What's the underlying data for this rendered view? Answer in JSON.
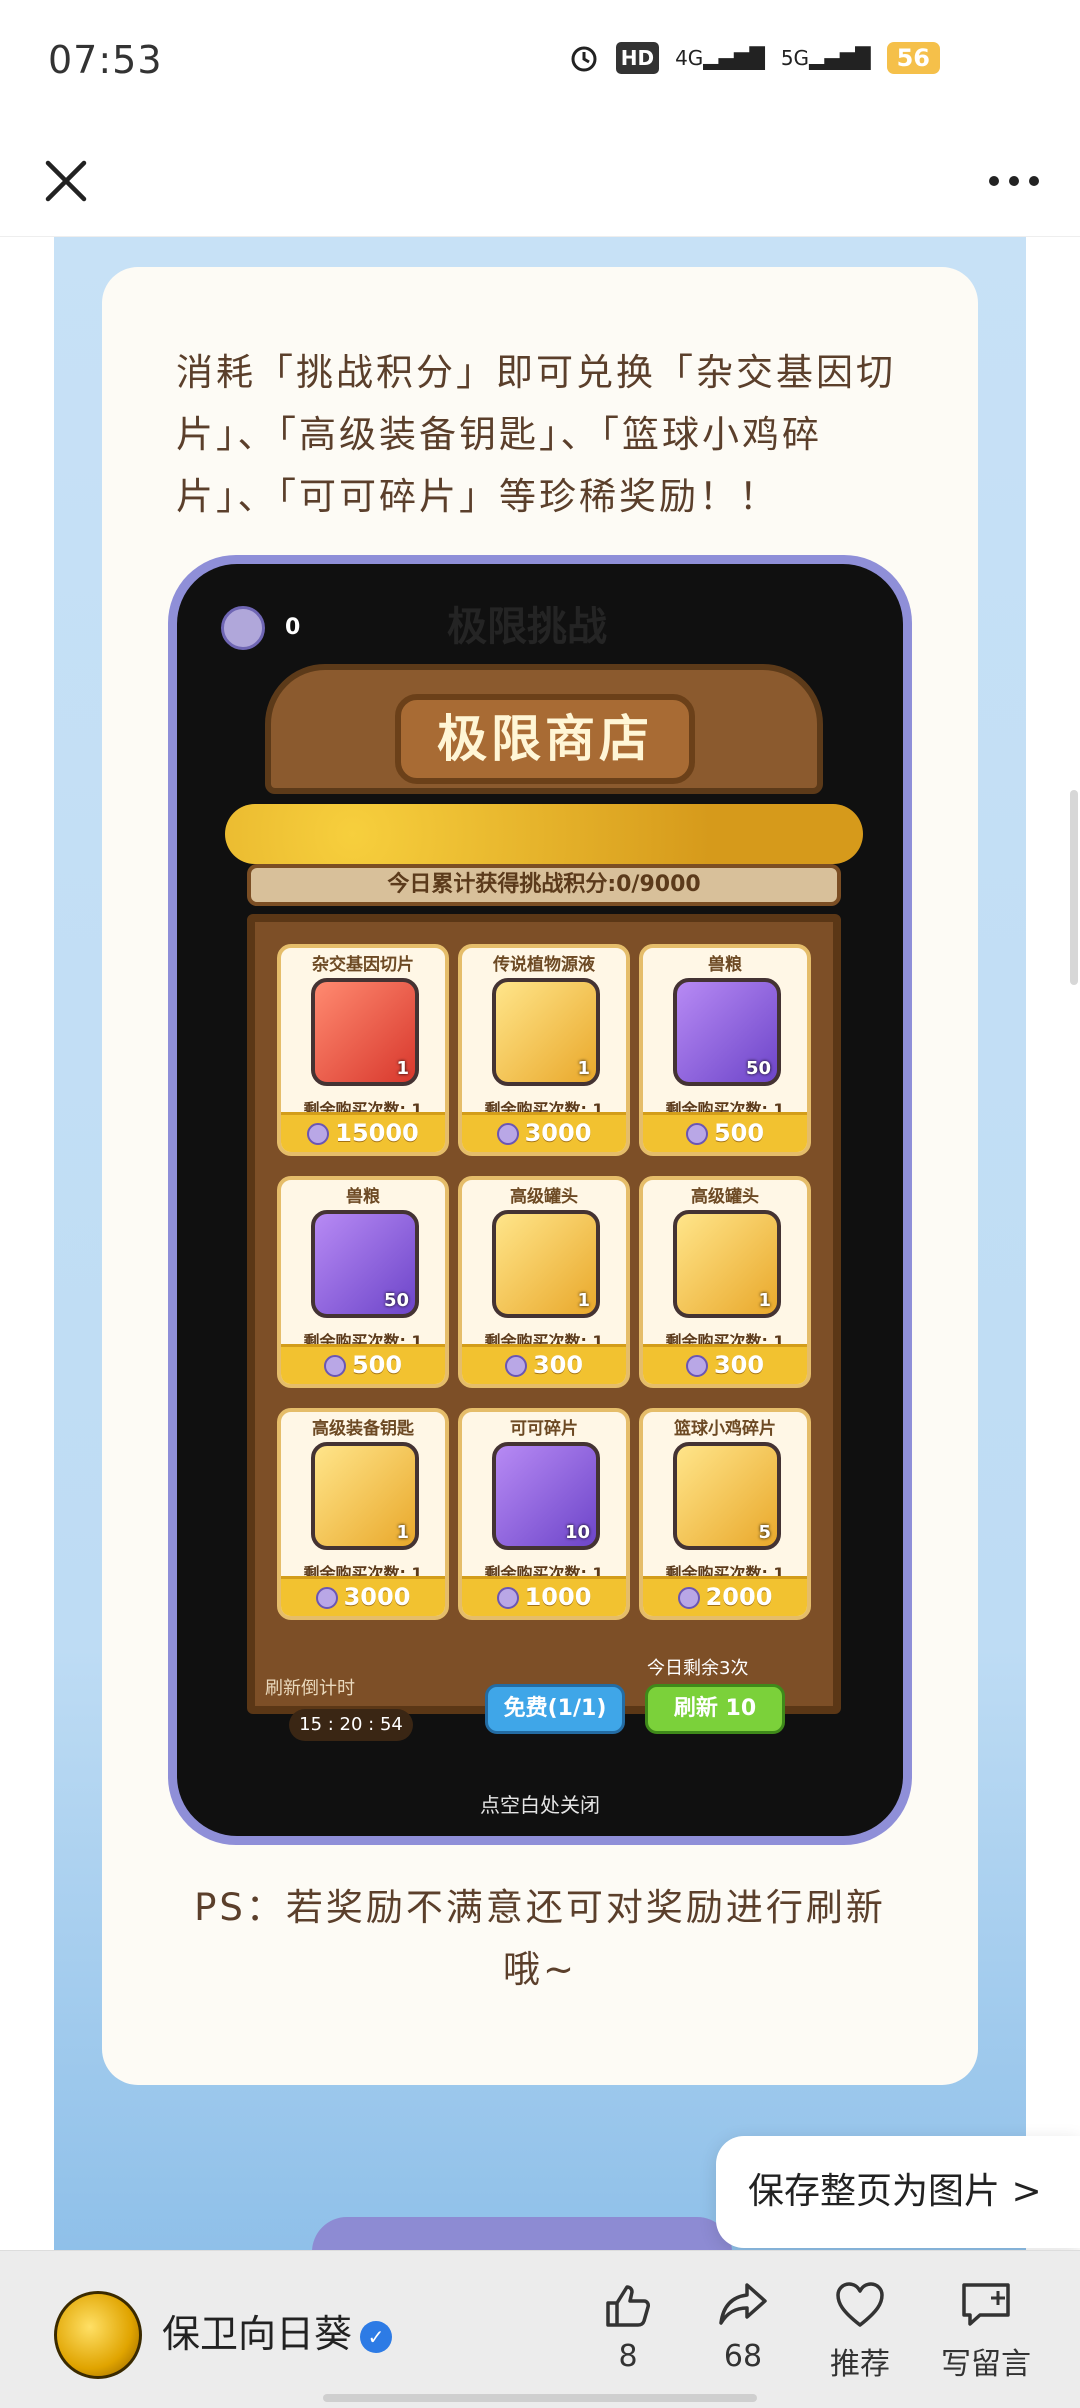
{
  "status_bar": {
    "time": "07:53",
    "hd": "HD",
    "net1": "4G",
    "net2": "5G",
    "battery": "56"
  },
  "article": {
    "intro": "消耗「挑战积分」即可兑换「杂交基因切片」、「高级装备钥匙」、「篮球小鸡碎片」、「可可碎片」等珍稀奖励！！",
    "ps": "PS：若奖励不满意还可对奖励进行刷新哦~"
  },
  "game": {
    "top_count": "0",
    "bg_title": "极限挑战",
    "shop_title": "极限商店",
    "points_bar": "今日累计获得挑战积分:0/9000",
    "items": [
      {
        "name": "杂交基因切片",
        "qty": "1",
        "remain": "剩余购买次数: 1",
        "price": "15000",
        "color": "red"
      },
      {
        "name": "传说植物源液",
        "qty": "1",
        "remain": "剩余购买次数: 1",
        "price": "3000",
        "color": "yellow"
      },
      {
        "name": "兽粮",
        "qty": "50",
        "remain": "剩余购买次数: 1",
        "price": "500",
        "color": "purple"
      },
      {
        "name": "兽粮",
        "qty": "50",
        "remain": "剩余购买次数: 1",
        "price": "500",
        "color": "purple"
      },
      {
        "name": "高级罐头",
        "qty": "1",
        "remain": "剩余购买次数: 1",
        "price": "300",
        "color": "yellow"
      },
      {
        "name": "高级罐头",
        "qty": "1",
        "remain": "剩余购买次数: 1",
        "price": "300",
        "color": "yellow"
      },
      {
        "name": "高级装备钥匙",
        "qty": "1",
        "remain": "剩余购买次数: 1",
        "price": "3000",
        "color": "yellow"
      },
      {
        "name": "可可碎片",
        "qty": "10",
        "remain": "剩余购买次数: 1",
        "price": "1000",
        "color": "purple"
      },
      {
        "name": "篮球小鸡碎片",
        "qty": "5",
        "remain": "剩余购买次数: 1",
        "price": "2000",
        "color": "yellow"
      }
    ],
    "refresh_label": "刷新倒计时",
    "timer": "15 : 20 : 54",
    "free_button": "免费(1/1)",
    "today_left": "今日剩余3次",
    "refresh_button": "刷新 10",
    "close_hint": "点空白处关闭"
  },
  "save_page_button": "保存整页为图片 >",
  "bottom_bar": {
    "account_name": "保卫向日葵",
    "like_count": "8",
    "share_count": "68",
    "recommend_label": "推荐",
    "comment_label": "写留言"
  }
}
